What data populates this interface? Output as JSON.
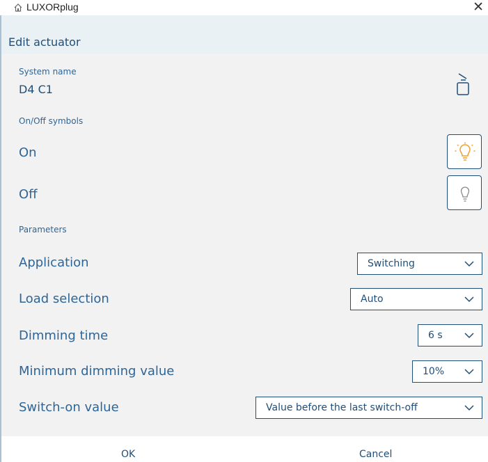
{
  "window": {
    "title": "LUXORplug",
    "app_icon": "house-plug-icon",
    "close_icon": "close-icon"
  },
  "header": {
    "title": "Edit actuator"
  },
  "system": {
    "label": "System name",
    "value": "D4 C1",
    "device_icon": "actuator-device-icon"
  },
  "symbols": {
    "label": "On/Off symbols",
    "on": {
      "label": "On",
      "icon": "bulb-on-icon",
      "color": "#f0a030"
    },
    "off": {
      "label": "Off",
      "icon": "bulb-off-icon",
      "color": "#8a8a8a"
    }
  },
  "parameters": {
    "label": "Parameters",
    "application": {
      "label": "Application",
      "value": "Switching"
    },
    "load_selection": {
      "label": "Load selection",
      "value": "Auto"
    },
    "dimming_time": {
      "label": "Dimming time",
      "value": "6 s"
    },
    "min_dimming": {
      "label": "Minimum dimming value",
      "value": "10%"
    },
    "switch_on": {
      "label": "Switch-on value",
      "value": "Value before the last switch-off"
    }
  },
  "footer": {
    "ok_label": "OK",
    "cancel_label": "Cancel"
  },
  "colors": {
    "accent": "#1f4e79",
    "label": "#2e6597",
    "panel_bg": "#f2f2f2",
    "header_bg": "#eaf1f5"
  }
}
